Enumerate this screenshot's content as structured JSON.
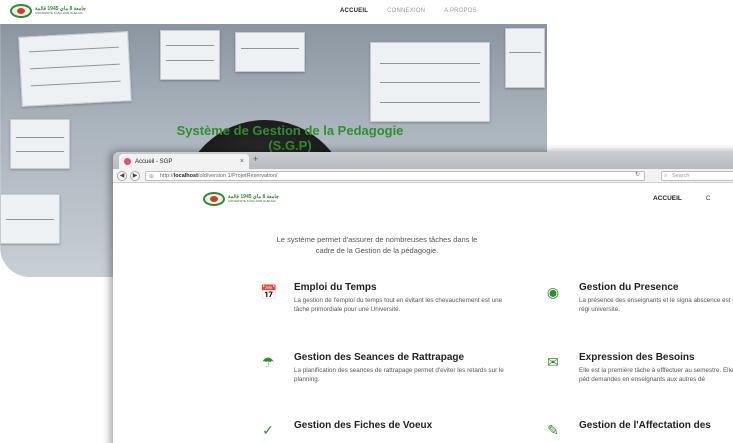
{
  "back_page": {
    "logo_text": "جامعة 8 ماي 1945 قالمة",
    "logo_sub": "UNIVERSITE 8 MAI 1945 GUELMA",
    "menu": [
      "ACCUEIL",
      "CONNEXION",
      "A PROPOS"
    ],
    "hero_title": "Système de Gestion de la Pedagogie",
    "hero_sub": "(S.G.P)"
  },
  "browser": {
    "tab_title": "Accueil - SGP",
    "tab_close": "×",
    "new_tab": "+",
    "url_prefix": "http://",
    "url_host": "localhost",
    "url_path": "/old/version 1/ProjetReservation/",
    "search_placeholder": "Search"
  },
  "site": {
    "logo_text": "جامعة 8 ماي 1945 قالمة",
    "logo_sub": "UNIVERSITE 8 MAI 1945 GUELMA",
    "menu": [
      "ACCUEIL",
      "C"
    ],
    "intro_line1": "Le système permet d'assurer de nombreuses tâches dans le",
    "intro_line2": "cadre de la Gestion de la pédagogie."
  },
  "features": [
    {
      "icon": "calendar-icon",
      "glyph": "📅",
      "title": "Emploi du Temps",
      "desc": "La gestion de l'emploi du temps tout en évitant les chevauchement est une tâche primordiale pour une Université."
    },
    {
      "icon": "eye-icon",
      "glyph": "◉",
      "title": "Gestion du Presence",
      "desc": "La présence des enseignants et le signa abscence est un problème urgent  à régi université."
    },
    {
      "icon": "umbrella-icon",
      "glyph": "☂",
      "title": "Gestion des Seances de Rattrapage",
      "desc": "La planification des seances de rattrapage permet d'eviter les retards sur le planning."
    },
    {
      "icon": "envelope-icon",
      "glyph": "✉",
      "title": "Expression des Besoins",
      "desc": "Elle est la première tâche à efffectuer au semestre. Elle permet au Chef de la péd demandes en enseignants aux autres dé"
    },
    {
      "icon": "check-circle-icon",
      "glyph": "✓",
      "title": "Gestion des Fiches de Voeux",
      "desc": ""
    },
    {
      "icon": "pencil-icon",
      "glyph": "✎",
      "title": "Gestion de l'Affectation des",
      "desc": ""
    }
  ],
  "colors": {
    "brand_green": "#2f8f2f",
    "favicon": "#e04f7a"
  }
}
